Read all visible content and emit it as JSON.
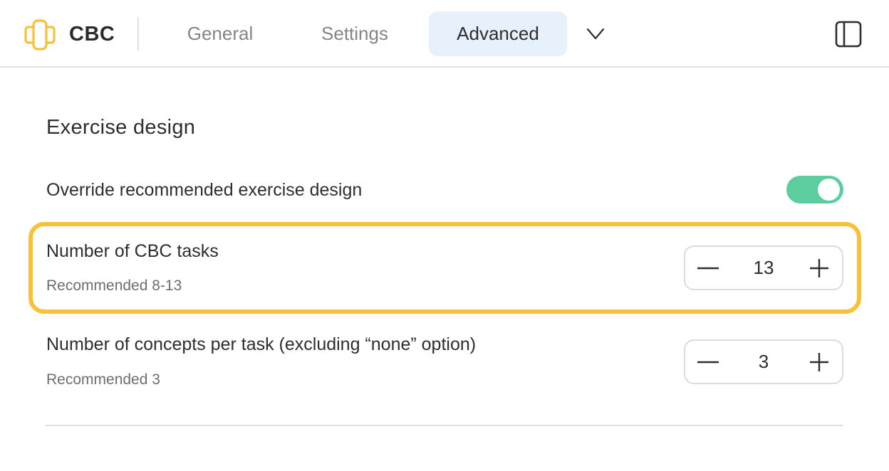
{
  "header": {
    "logo_icon": "cbc-logo-icon",
    "brand": "CBC",
    "tabs": [
      {
        "label": "General",
        "active": false
      },
      {
        "label": "Settings",
        "active": false
      },
      {
        "label": "Advanced",
        "active": true
      }
    ],
    "more_icon": "chevron-down-icon",
    "panel_icon": "sidebar-panel-icon"
  },
  "colors": {
    "accent_logo": "#f7c139",
    "active_tab_bg": "#e6f1fb",
    "toggle_on": "#5ccd9e",
    "highlight_border": "#f7c139"
  },
  "content": {
    "section_title": "Exercise design",
    "override": {
      "label": "Override recommended exercise design",
      "enabled": true
    },
    "settings": [
      {
        "label": "Number of CBC tasks",
        "recommendation": "Recommended 8-13",
        "value": "13",
        "highlighted": true
      },
      {
        "label": "Number of concepts per task (excluding “none” option)",
        "recommendation": "Recommended 3",
        "value": "3",
        "highlighted": false
      }
    ]
  }
}
